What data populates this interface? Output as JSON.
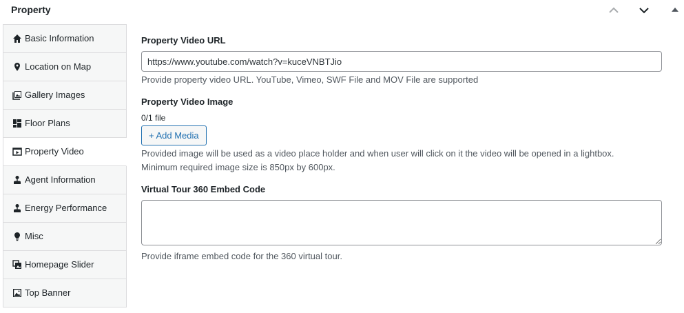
{
  "metabox": {
    "title": "Property",
    "controls": [
      {
        "name": "move-up",
        "icon": "chevron-up-icon"
      },
      {
        "name": "move-down",
        "icon": "chevron-down-icon"
      },
      {
        "name": "toggle-panel",
        "icon": "triangle-up-icon"
      }
    ]
  },
  "sidebar": {
    "items": [
      {
        "label": "Basic Information",
        "icon": "home-icon",
        "active": false
      },
      {
        "label": "Location on Map",
        "icon": "location-pin-icon",
        "active": false
      },
      {
        "label": "Gallery Images",
        "icon": "gallery-icon",
        "active": false
      },
      {
        "label": "Floor Plans",
        "icon": "floor-plan-icon",
        "active": false
      },
      {
        "label": "Property Video",
        "icon": "video-icon",
        "active": true
      },
      {
        "label": "Agent Information",
        "icon": "person-icon",
        "active": false
      },
      {
        "label": "Energy Performance",
        "icon": "person-icon",
        "active": false
      },
      {
        "label": "Misc",
        "icon": "lightbulb-icon",
        "active": false
      },
      {
        "label": "Homepage Slider",
        "icon": "slides-icon",
        "active": false
      },
      {
        "label": "Top Banner",
        "icon": "image-icon",
        "active": false
      }
    ]
  },
  "video_url": {
    "label": "Property Video URL",
    "value": "https://www.youtube.com/watch?v=kuceVNBTJio",
    "description": "Provide property video URL. YouTube, Vimeo, SWF File and MOV File are supported"
  },
  "video_image": {
    "label": "Property Video Image",
    "file_count": "0/1 file",
    "add_media_label": "+ Add Media",
    "description_line1": "Provided image will be used as a video place holder and when user will click on it the video will be opened in a lightbox.",
    "description_line2": "Minimum required image size is 850px by 600px."
  },
  "virtual_tour": {
    "label": "Virtual Tour 360 Embed Code",
    "value": "",
    "description": "Provide iframe embed code for the 360 virtual tour."
  },
  "colors": {
    "accent": "#2271b1",
    "border": "#dcdcde",
    "tab_bg": "#f6f7f7",
    "text": "#1d2327",
    "muted_text": "#50575e"
  }
}
